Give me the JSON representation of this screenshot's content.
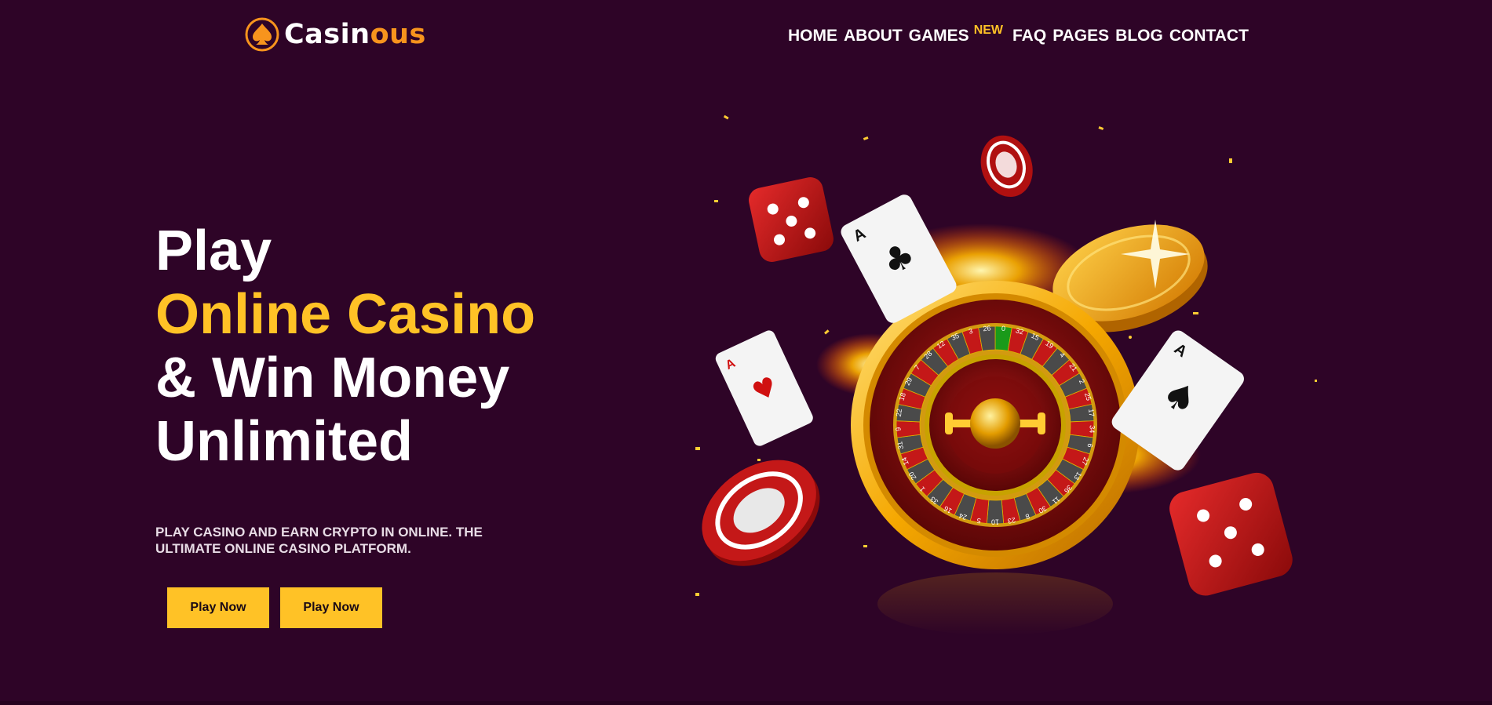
{
  "brand": {
    "name_part1": "Casin",
    "name_part2": "ous",
    "logo_icon": "spade-icon"
  },
  "nav": {
    "items": [
      {
        "label": "HOME"
      },
      {
        "label": "ABOUT"
      },
      {
        "label": "GAMES"
      },
      {
        "label": "FAQ"
      },
      {
        "label": "PAGES"
      },
      {
        "label": "BLOG"
      },
      {
        "label": "CONTACT"
      }
    ],
    "games_badge": "NEW"
  },
  "hero": {
    "line1": "Play",
    "line2": "Online Casino",
    "line3": "& Win Money",
    "line4": "Unlimited",
    "subtitle": "PLAY CASINO AND EARN CRYPTO IN ONLINE. THE ULTIMATE ONLINE CASINO PLATFORM.",
    "button1": "Play Now",
    "button2": "Play Now"
  },
  "roulette_numbers": [
    "0",
    "32",
    "15",
    "19",
    "4",
    "21",
    "2",
    "25",
    "17",
    "34",
    "6",
    "27",
    "13",
    "36",
    "11",
    "30",
    "8",
    "23",
    "10",
    "5",
    "24",
    "16",
    "33",
    "1",
    "20",
    "14",
    "31",
    "9",
    "22",
    "18",
    "29",
    "7",
    "28",
    "12",
    "35",
    "3",
    "26"
  ],
  "colors": {
    "background": "#2e0427",
    "accent": "#ffc226",
    "brand_orange": "#f7941d",
    "text": "#ffffff"
  }
}
